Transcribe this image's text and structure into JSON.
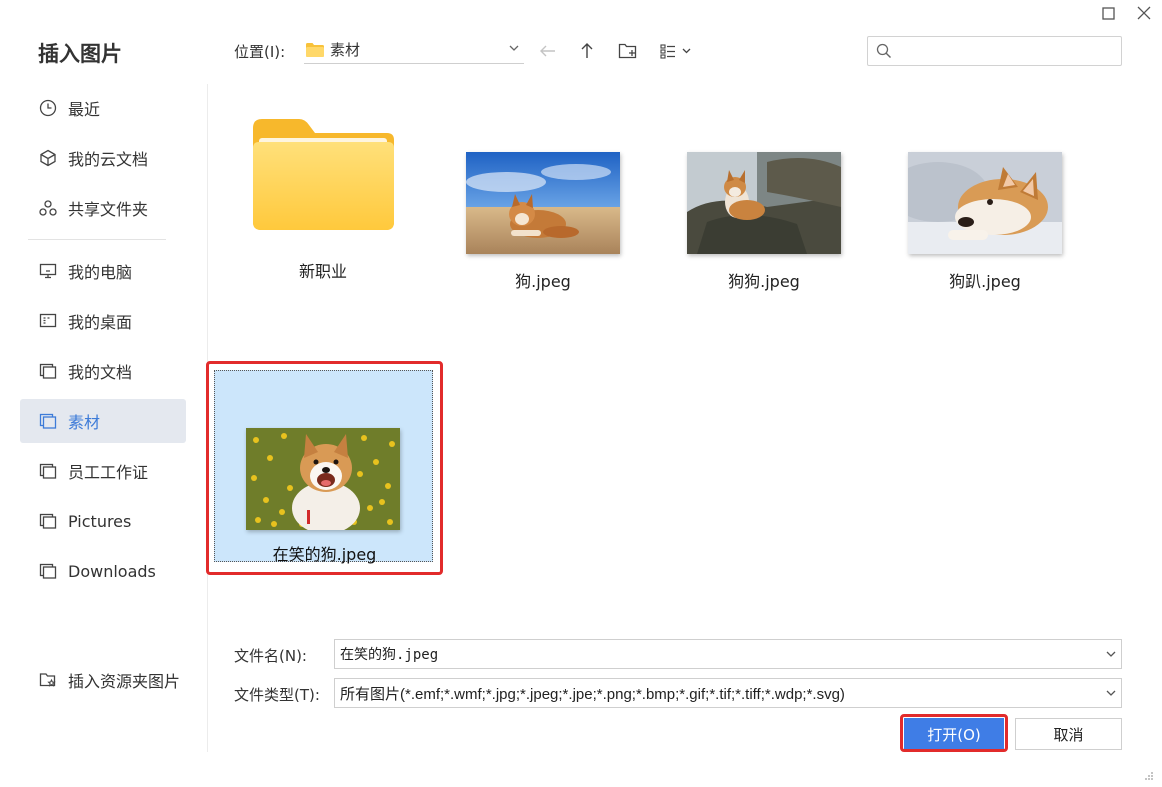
{
  "dialog": {
    "title": "插入图片"
  },
  "sidebar": {
    "items": [
      {
        "label": "最近",
        "icon": "clock-icon"
      },
      {
        "label": "我的云文档",
        "icon": "cube-icon"
      },
      {
        "label": "共享文件夹",
        "icon": "share-icon"
      },
      {
        "label": "我的电脑",
        "icon": "monitor-icon"
      },
      {
        "label": "我的桌面",
        "icon": "desktop-icon"
      },
      {
        "label": "我的文档",
        "icon": "folder-icon"
      },
      {
        "label": "素材",
        "icon": "folder-icon",
        "active": true
      },
      {
        "label": "员工工作证",
        "icon": "folder-icon"
      },
      {
        "label": "Pictures",
        "icon": "folder-icon"
      },
      {
        "label": "Downloads",
        "icon": "folder-icon"
      }
    ],
    "bottom_item": {
      "label": "插入资源夹图片",
      "icon": "star-folder-icon"
    }
  },
  "toolbar": {
    "location_label": "位置(I):",
    "location_value": "素材",
    "search_placeholder": ""
  },
  "files": [
    {
      "name": "新职业",
      "type": "folder"
    },
    {
      "name": "狗.jpeg",
      "type": "image"
    },
    {
      "name": "狗狗.jpeg",
      "type": "image"
    },
    {
      "name": "狗趴.jpeg",
      "type": "image"
    },
    {
      "name": "在笑的狗.jpeg",
      "type": "image",
      "selected": true
    }
  ],
  "form": {
    "filename_label": "文件名(N):",
    "filename_value": "在笑的狗.jpeg",
    "filetype_label": "文件类型(T):",
    "filetype_value": "所有图片(*.emf;*.wmf;*.jpg;*.jpeg;*.jpe;*.png;*.bmp;*.gif;*.tif;*.tiff;*.wdp;*.svg)"
  },
  "buttons": {
    "open_label": "打开(O)",
    "cancel_label": "取消"
  },
  "colors": {
    "accent": "#3f7de6",
    "selection": "#cce6fb",
    "highlight": "#e22b2b",
    "active_sidebar": "#e4e8ef"
  }
}
